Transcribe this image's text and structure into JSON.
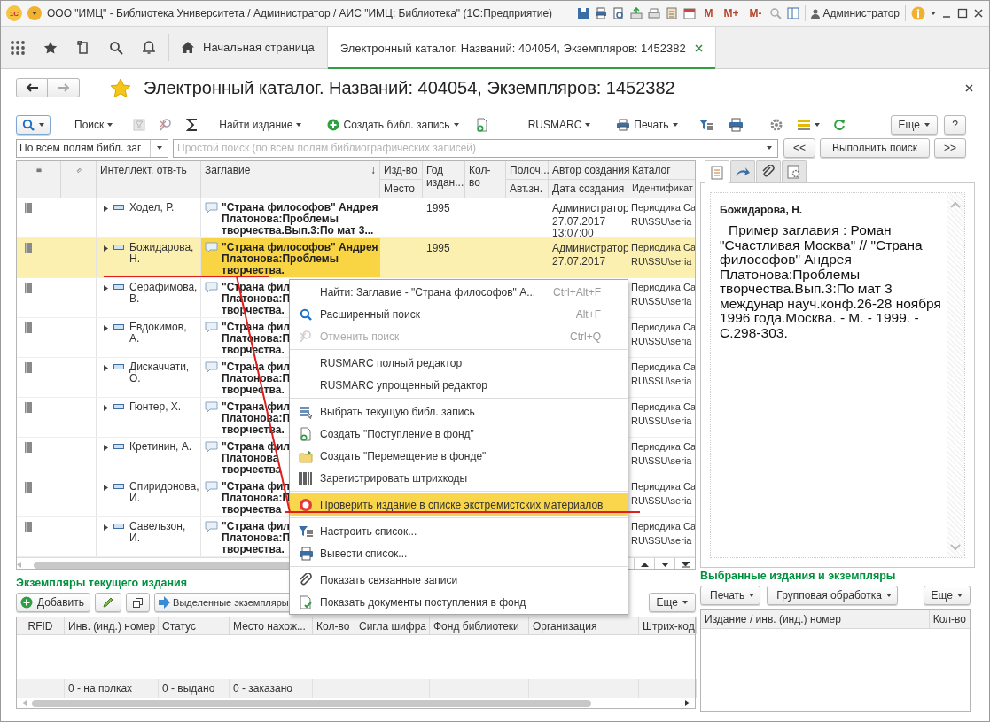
{
  "window": {
    "logo": "1С",
    "title": "ООО \"ИМЦ\" - Библиотека Университета / Администратор / АИС \"ИМЦ: Библиотека\"  (1С:Предприятие)",
    "memory_buttons": [
      "M",
      "M+",
      "M-"
    ],
    "user": "Администратор"
  },
  "nav": {
    "tabs": [
      {
        "label": "Начальная страница",
        "selected": false,
        "closable": false
      },
      {
        "label": "Электронный каталог. Названий: 404054, Экземпляров: 1452382",
        "selected": true,
        "closable": true
      }
    ]
  },
  "form": {
    "title": "Электронный каталог. Названий: 404054, Экземпляров: 1452382"
  },
  "toolbar": {
    "items": [
      {
        "kind": "search-menu"
      },
      {
        "kind": "menu",
        "label": "Поиск"
      },
      {
        "kind": "icon",
        "disabled": true
      },
      {
        "kind": "icon",
        "disabled": false
      },
      {
        "kind": "icon",
        "disabled": false
      },
      {
        "kind": "menu",
        "label": "Найти издание"
      },
      {
        "kind": "menu",
        "label": "Создать библ. запись"
      },
      {
        "kind": "icon",
        "disabled": false
      },
      {
        "kind": "menu",
        "label": "RUSMARC"
      },
      {
        "kind": "menu",
        "label": "Печать"
      },
      {
        "kind": "icon",
        "disabled": false
      },
      {
        "kind": "icon",
        "disabled": false
      },
      {
        "kind": "icon",
        "disabled": false
      },
      {
        "kind": "icon-menu"
      },
      {
        "kind": "icon",
        "disabled": false
      }
    ],
    "more": "Еще",
    "help": "?"
  },
  "search": {
    "field": "По всем полям библ. заг",
    "placeholder": "Простой поиск (по всем полям библиографических записей)",
    "prev": "<<",
    "run": "Выполнить поиск",
    "next": ">>"
  },
  "table": {
    "columns": [
      {
        "label": "Интеллект. отв-ть"
      },
      {
        "label": "Заглавие",
        "sort_mark": "↓"
      },
      {
        "label": "Изд-во",
        "sub": "Место"
      },
      {
        "label": "Год издан..."
      },
      {
        "label": "Кол-во"
      },
      {
        "label": "Полоч...",
        "sub": "Авт.зн."
      },
      {
        "label": "Автор создания",
        "sub": "Дата создания"
      },
      {
        "label": "Каталог",
        "sub": "Идентификат"
      }
    ],
    "rows": [
      {
        "selected": false,
        "author": "Ходел, Р.",
        "title": [
          "\"Страна философов\" Андрея",
          "Платонова:Проблемы",
          "творчества.Вып.3:По мат 3..."
        ],
        "year": "1995",
        "creator": "Администратор",
        "created": "27.07.2017 13:07:00",
        "catalog": "Периодика Са",
        "identifier": "RU\\SSU\\seria"
      },
      {
        "selected": true,
        "author": "Божидарова, Н.",
        "title": [
          "\"Страна философов\" Андрея",
          "Платонова:Проблемы",
          "творчества."
        ],
        "year": "1995",
        "creator": "Администратор",
        "created": "27.07.2017",
        "catalog": "Периодика Са",
        "identifier": "RU\\SSU\\seria"
      },
      {
        "selected": false,
        "author": "Серафимова, В.",
        "title": [
          "\"Страна фил",
          "Платонова:П",
          "творчества."
        ],
        "catalog": "Периодика Са",
        "identifier": "RU\\SSU\\seria"
      },
      {
        "selected": false,
        "author": "Евдокимов, А.",
        "title": [
          "\"Страна фил",
          "Платонова:П",
          "творчества."
        ],
        "catalog": "Периодика Са",
        "identifier": "RU\\SSU\\seria"
      },
      {
        "selected": false,
        "author": "Дискаччати, О.",
        "title": [
          "\"Страна фил",
          "Платонова:П",
          "творчества."
        ],
        "catalog": "Периодика Са",
        "identifier": "RU\\SSU\\seria"
      },
      {
        "selected": false,
        "author": "Гюнтер, Х.",
        "title": [
          "\"Страна фил",
          "Платонова:П",
          "творчества."
        ],
        "catalog": "Периодика Са",
        "identifier": "RU\\SSU\\seria"
      },
      {
        "selected": false,
        "author": "Кретинин, А.",
        "title": [
          "\"Страна фил",
          "Платонова",
          "творчества"
        ],
        "catalog": "Периодика Са",
        "identifier": "RU\\SSU\\seria"
      },
      {
        "selected": false,
        "author": "Спиридонова, И.",
        "title": [
          "\"Страна фил",
          "Платонова:П",
          "творчества"
        ],
        "catalog": "Периодика Са",
        "identifier": "RU\\SSU\\seria"
      },
      {
        "selected": false,
        "author": "Савельзон, И.",
        "title": [
          "\"Страна фил",
          "Платонова:П",
          "творчества."
        ],
        "catalog": "Периодика Са",
        "identifier": "RU\\SSU\\seria"
      }
    ]
  },
  "preview": {
    "tabs": [
      {
        "selected": true
      },
      {
        "selected": false
      },
      {
        "selected": false
      },
      {
        "selected": false
      }
    ],
    "author": "Божидарова, Н.",
    "text": "Пример заглавия : Роман \"Счастливая Москва\" // \"Страна философов\" Андрея Платонова:Проблемы творчества.Вып.3:По мат 3 междунар науч.конф.26-28 ноября 1996 года.Москва. - М. - 1999. - С.298-303."
  },
  "copies": {
    "title": "Экземпляры текущего издания",
    "add": "Добавить",
    "selected_copies": "Выделенные экземпляры",
    "more": "Еще",
    "columns": [
      "RFID",
      "Инв. (инд.) номер",
      "Статус",
      "Место нахож...",
      "Кол-во",
      "Сигла шифра",
      "Фонд библиотеки",
      "Организация",
      "Штрих-код"
    ],
    "totals": [
      "0 - на полках",
      "0 - выдано",
      "0 - заказано"
    ]
  },
  "selected_items": {
    "title": "Выбранные издания и экземпляры",
    "buttons": [
      "Печать",
      "Групповая обработка"
    ],
    "more": "Еще",
    "columns": [
      "Издание / инв. (инд.) номер",
      "Кол-во"
    ]
  },
  "menu": {
    "groups": [
      [
        {
          "label": "Найти: Заглавие - \"Страна философов\" А...",
          "shortcut": "Ctrl+Alt+F",
          "disabled": false,
          "highlighted": false
        },
        {
          "label": "Расширенный поиск",
          "shortcut": "Alt+F",
          "disabled": false,
          "highlighted": false
        },
        {
          "label": "Отменить поиск",
          "shortcut": "Ctrl+Q",
          "disabled": true,
          "highlighted": false
        }
      ],
      [
        {
          "label": "RUSMARC полный редактор",
          "disabled": false,
          "highlighted": false
        },
        {
          "label": "RUSMARC упрощенный редактор",
          "disabled": false,
          "highlighted": false
        }
      ],
      [
        {
          "label": "Выбрать текущую библ. запись",
          "disabled": false,
          "highlighted": false
        },
        {
          "label": "Создать \"Поступление в фонд\"",
          "disabled": false,
          "highlighted": false
        },
        {
          "label": "Создать \"Перемещение в фонде\"",
          "disabled": false,
          "highlighted": false
        },
        {
          "label": "Зарегистрировать штрихкоды",
          "disabled": false,
          "highlighted": false
        }
      ],
      [
        {
          "label": "Проверить издание в списке экстремистских материалов",
          "disabled": false,
          "highlighted": true
        }
      ],
      [
        {
          "label": "Настроить список...",
          "disabled": false,
          "highlighted": false
        },
        {
          "label": "Вывести список...",
          "disabled": false,
          "highlighted": false
        }
      ],
      [
        {
          "label": "Показать связанные записи",
          "disabled": false,
          "highlighted": false
        },
        {
          "label": "Показать документы поступления в фонд",
          "disabled": false,
          "highlighted": false
        }
      ]
    ]
  }
}
